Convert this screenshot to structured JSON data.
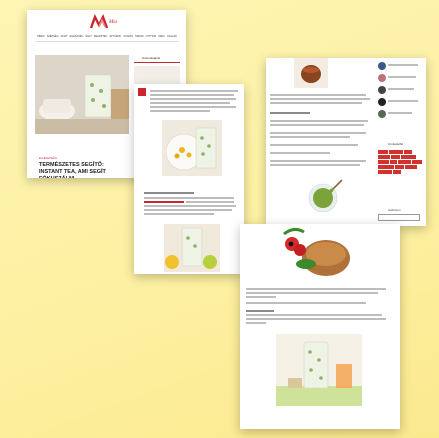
{
  "page1": {
    "logo_text": "Mia",
    "nav_items": [
      "HÍREK",
      "SZÉPSÉG",
      "DIVAT",
      "EGÉSZSÉG",
      "ÉLET",
      "RECEPTEK",
      "SZTÁROK",
      "UTAZÁS",
      "TREND",
      "OTTHON",
      "SZEX",
      "CSALÁD"
    ],
    "sidebar_heading": "Hírlevélajánló",
    "category": "EGÉSZSÉG",
    "article_title": "TERMÉSZETES SEGÍTŐ: INSTANT TEA, AMI SEGÍT FÓKUSZÁLNI"
  },
  "page3": {
    "sidebar_tags_heading": "Címkefelhő",
    "sidebar_archive_heading": "Archívum"
  },
  "colors": {
    "background": "#fdf2a8",
    "accent_red": "#c9272b",
    "matcha_green": "#7aa33a"
  }
}
